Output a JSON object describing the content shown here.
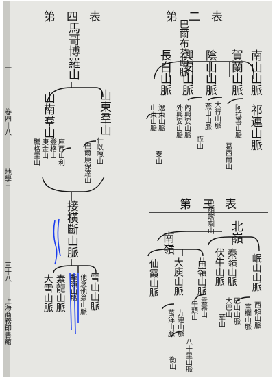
{
  "colors": {
    "paper": "#e7e7e3",
    "ink": "#161616",
    "annotation": "#1b3df0"
  },
  "margin": {
    "chars": [
      "一",
      "卷四十八",
      "地學三",
      "三十八",
      "上海商務印書館"
    ]
  },
  "table4": {
    "header": "第四表",
    "top": "馬哥博羅山",
    "east": {
      "name": "山東羣山",
      "subs": [
        "什以嘎山",
        "巴爾庚保達山"
      ]
    },
    "south": {
      "name": "山南羣山",
      "subs": [
        "庫西山利",
        "登格山",
        "庚金山",
        "騰格里山"
      ]
    },
    "junction": "接橫斷山脈",
    "bottom": [
      "雪山山脈",
      "他念他翁山脈",
      "擊嶺山脈",
      "素龍山脈",
      "大雪山脈"
    ]
  },
  "table2": {
    "header": "第二表",
    "top": "巴爾布芬山脈",
    "columns": [
      {
        "name": "南山山脈",
        "subs": []
      },
      {
        "name": "祁連山脈",
        "subs": []
      },
      {
        "name": "賀蘭山脈",
        "subs": [
          "阿拉善山脈",
          "葛西爾山"
        ]
      },
      {
        "name": "陰山山脈",
        "subs": [
          "大行山脈",
          "燕山山脈",
          "恆山"
        ]
      },
      {
        "name": "興安山脈",
        "subs": [
          "內興安山脈",
          "外興安山脈"
        ]
      },
      {
        "name": "長白山脈",
        "subs": [
          "遼東山脈",
          "山東山脈",
          "泰山"
        ]
      }
    ]
  },
  "table3": {
    "header": "第三表",
    "top": "巴顏喀喇山",
    "north": {
      "name": "北嶺",
      "subs": [
        {
          "name": "岷山山脈",
          "children": [
            "西傾山脈",
            "雪欄山脈"
          ]
        },
        {
          "name": "秦嶺山脈",
          "children": [
            "巴山山脈",
            "大巴山"
          ]
        },
        {
          "name": "伏牛山脈",
          "children": [
            "華山"
          ]
        }
      ]
    },
    "south": {
      "name": "南嶺",
      "subs": [
        {
          "name": "苗嶺山脈",
          "children": [
            "雲霧山",
            "牛頭山"
          ]
        },
        {
          "name": "大庾山脈",
          "children": [
            "九連山脈",
            "萬洋山脈"
          ]
        },
        {
          "name": "仙霞山脈",
          "children": [
            "八十里山脈",
            "衡山"
          ]
        }
      ]
    }
  }
}
